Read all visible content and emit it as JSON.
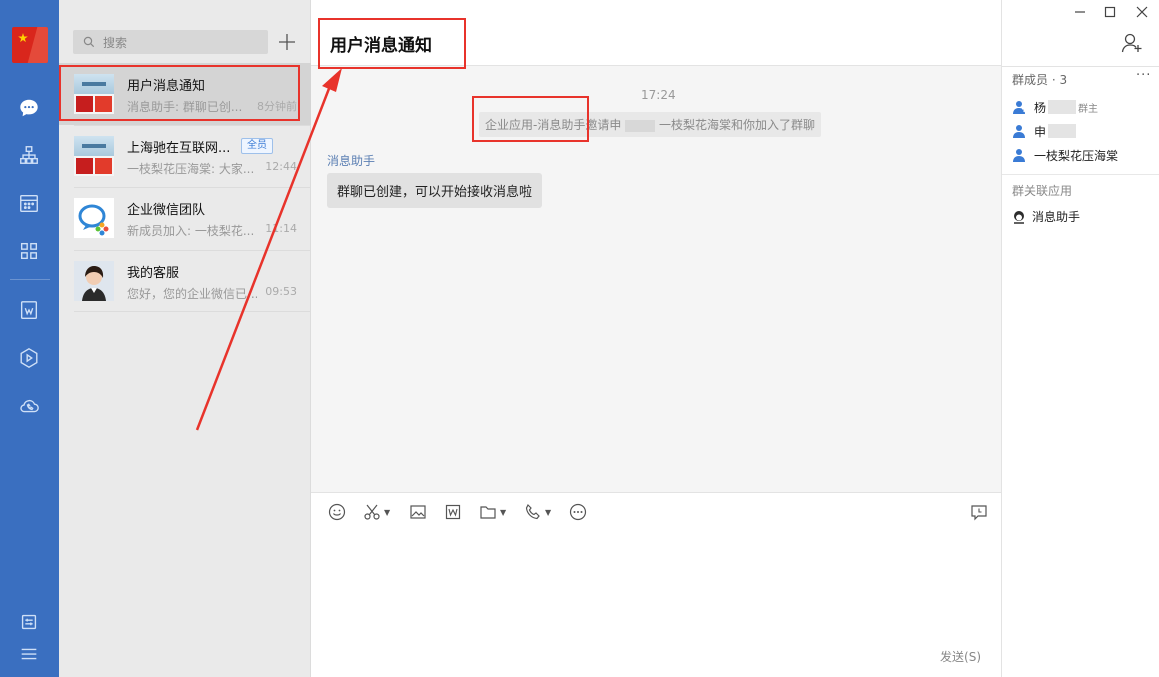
{
  "rail": {
    "items": [
      "chat-icon",
      "contacts-icon",
      "calendar-icon",
      "apps-icon",
      "doc-icon",
      "drive-icon",
      "call-icon",
      "settings-icon",
      "menu-icon"
    ]
  },
  "search": {
    "placeholder": "搜索"
  },
  "conversations": [
    {
      "name": "用户消息通知",
      "snippet": "消息助手: 群聊已创...",
      "time": "8分钟前",
      "badge": ""
    },
    {
      "name": "上海驰在互联网...",
      "snippet": "一枝梨花压海棠: 大家...",
      "time": "12:44",
      "badge": "全员"
    },
    {
      "name": "企业微信团队",
      "snippet": "新成员加入: 一枝梨花...",
      "time": "11:14",
      "badge": ""
    },
    {
      "name": "我的客服",
      "snippet": "您好，您的企业微信已...",
      "time": "09:53",
      "badge": ""
    }
  ],
  "chat": {
    "title": "用户消息通知",
    "system_time": "17:24",
    "system_message_part1": "企业应用-消息助手邀请申",
    "system_message_part2": "一枝梨花海棠和你加入了群聊",
    "sender": "消息助手",
    "message": "群聊已创建，可以开始接收消息啦",
    "send_label": "发送(S)"
  },
  "panel": {
    "members_title": "群成员 · 3",
    "more": "···",
    "members": [
      {
        "name": "杨",
        "role": "群主"
      },
      {
        "name": "申",
        "role": ""
      },
      {
        "name": "一枝梨花压海棠",
        "role": ""
      }
    ],
    "apps_title": "群关联应用",
    "app_name": "消息助手"
  },
  "colors": {
    "rail_bg": "#3a6fc0",
    "highlight": "#e8332b",
    "link": "#5b7fb3"
  }
}
